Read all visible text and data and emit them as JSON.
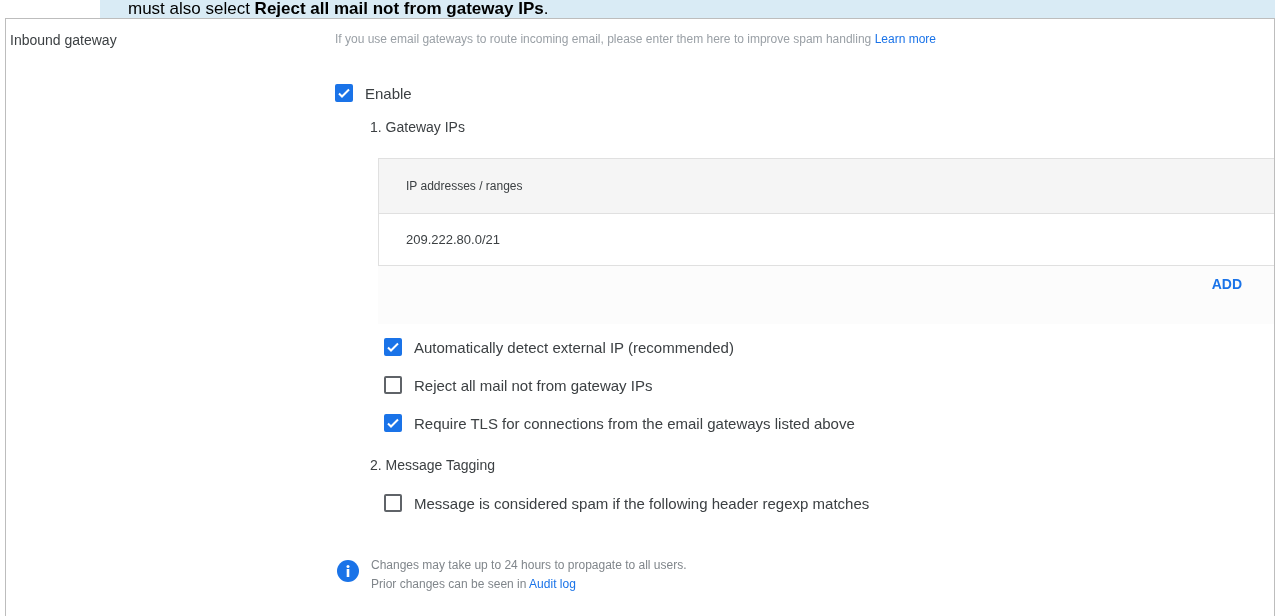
{
  "banner": {
    "text": "must also select **Reject all mail not from gateway IPs**."
  },
  "setting": {
    "label": "Inbound gateway",
    "description": "If you use email gateways to route incoming email, please enter them here to improve spam handling",
    "learn_more": "Learn more",
    "enable": {
      "label": "Enable",
      "checked": true
    },
    "section_1": "1. Gateway IPs",
    "table": {
      "columns": [
        "IP addresses / ranges"
      ],
      "rows": [
        [
          "209.222.80.0/21"
        ]
      ]
    },
    "add_button": "ADD",
    "options": [
      {
        "label": "Automatically detect external IP (recommended)",
        "checked": true
      },
      {
        "label": "Reject all mail not from gateway IPs",
        "checked": false
      },
      {
        "label": "Require TLS for connections from the email gateways listed above",
        "checked": true
      }
    ],
    "section_2": "2. Message Tagging",
    "tagging_options": [
      {
        "label": "Message is considered spam if the following header regexp matches",
        "checked": false
      }
    ],
    "note": {
      "line_1": "Changes may take up to 24 hours to propagate to all users.",
      "line_2": "Prior changes can be seen in",
      "link": "Audit log"
    }
  }
}
